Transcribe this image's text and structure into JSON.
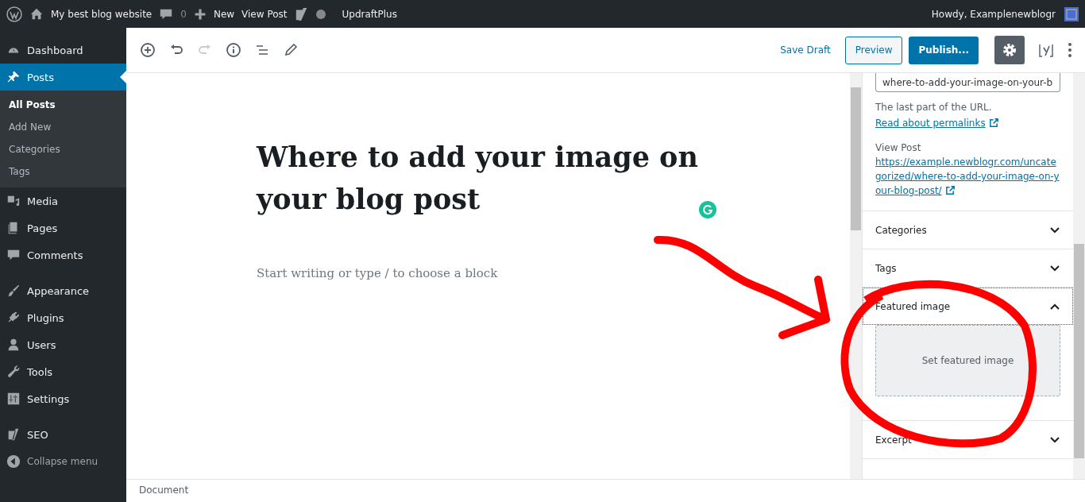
{
  "admin_bar": {
    "site_name": "My best blog website",
    "comments_count": "0",
    "new_label": "New",
    "view_post": "View Post",
    "updraft": "UpdraftPlus",
    "greeting": "Howdy, Examplenewblogr"
  },
  "menu": [
    {
      "label": "Dashboard",
      "selected": false
    },
    {
      "label": "Posts",
      "selected": true,
      "children": [
        {
          "label": "All Posts",
          "selected": true
        },
        {
          "label": "Add New",
          "selected": false
        },
        {
          "label": "Categories",
          "selected": false
        },
        {
          "label": "Tags",
          "selected": false
        }
      ]
    },
    {
      "label": "Media",
      "selected": false
    },
    {
      "label": "Pages",
      "selected": false
    },
    {
      "label": "Comments",
      "selected": false
    },
    {
      "label": "Appearance",
      "selected": false
    },
    {
      "label": "Plugins",
      "selected": false
    },
    {
      "label": "Users",
      "selected": false
    },
    {
      "label": "Tools",
      "selected": false
    },
    {
      "label": "Settings",
      "selected": false
    },
    {
      "label": "SEO",
      "selected": false
    }
  ],
  "collapse_label": "Collapse menu",
  "toolbar": {
    "save_draft": "Save Draft",
    "preview": "Preview",
    "publish": "Publish...",
    "settings_on": true
  },
  "editor": {
    "title": "Where to add your image on your blog post",
    "placeholder": "Start writing or type / to choose a block"
  },
  "settings": {
    "slug": "where-to-add-your-image-on-your-b",
    "help": "The last part of the URL.",
    "help_link": "Read about permalinks",
    "view_post_label": "View Post",
    "url": "https://example.newblogr.com/uncategorized/where-to-add-your-image-on-your-blog-post/",
    "panels": [
      {
        "title": "Categories",
        "expanded": false
      },
      {
        "title": "Tags",
        "expanded": false
      },
      {
        "title": "Featured image",
        "expanded": true,
        "button": "Set featured image"
      },
      {
        "title": "Excerpt",
        "expanded": false
      }
    ]
  },
  "footer": "Document"
}
